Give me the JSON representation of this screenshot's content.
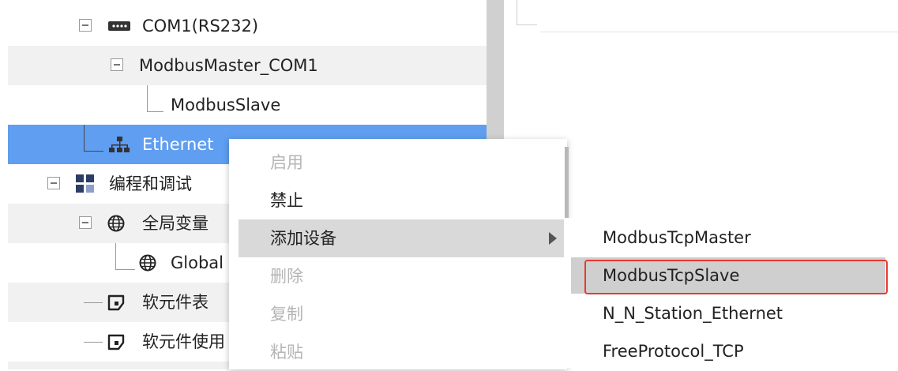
{
  "tree": {
    "rows": [
      {
        "label": "COM1(RS232)",
        "icon": "serial-port-icon"
      },
      {
        "label": "ModbusMaster_COM1"
      },
      {
        "label": "ModbusSlave"
      },
      {
        "label": "Ethernet",
        "icon": "network-icon",
        "selected": true
      },
      {
        "label": "编程和调试",
        "icon": "grid-icon"
      },
      {
        "label": "全局变量",
        "icon": "globe-icon"
      },
      {
        "label": "Global",
        "icon": "globe-icon"
      },
      {
        "label": "软元件表",
        "icon": "table-icon"
      },
      {
        "label": "软元件使用",
        "icon": "table-icon"
      }
    ]
  },
  "context_menu": {
    "items": [
      {
        "label": "启用",
        "enabled": false
      },
      {
        "label": "禁止",
        "enabled": true
      },
      {
        "label": "添加设备",
        "enabled": true,
        "has_submenu": true,
        "highlighted": true
      },
      {
        "label": "删除",
        "enabled": false
      },
      {
        "label": "复制",
        "enabled": false
      },
      {
        "label": "粘贴",
        "enabled": false
      }
    ]
  },
  "submenu": {
    "items": [
      {
        "label": "ModbusTcpMaster"
      },
      {
        "label": "ModbusTcpSlave",
        "highlighted": true
      },
      {
        "label": "N_N_Station_Ethernet"
      },
      {
        "label": "FreeProtocol_TCP"
      }
    ]
  },
  "colors": {
    "selection": "#5f9ef0",
    "highlight_box": "#e83a2e",
    "menu_highlight": "#d9d9d9"
  }
}
